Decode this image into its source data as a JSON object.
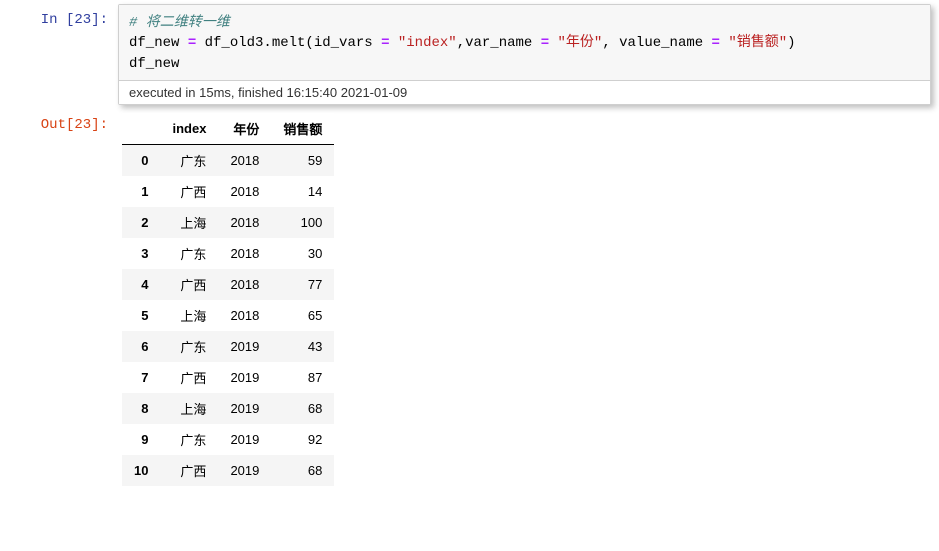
{
  "in_prompt": "In [23]:",
  "out_prompt": "Out[23]:",
  "code": {
    "comment": "# 将二维转一维",
    "line2_pre": "df_new ",
    "eq": "=",
    "line2_mid": " df_old3.melt(id_vars ",
    "line2_s1": "\"index\"",
    "line2_c1": ",var_name ",
    "line2_s2": "\"年份\"",
    "line2_c2": ", value_name ",
    "line2_s3": "\"销售额\"",
    "line2_end": ")",
    "line3": "df_new"
  },
  "exec_info": "executed in 15ms, finished 16:15:40 2021-01-09",
  "chart_data": {
    "type": "table",
    "columns": [
      "index",
      "年份",
      "销售额"
    ],
    "rows": [
      {
        "i": "0",
        "c0": "广东",
        "c1": "2018",
        "c2": "59"
      },
      {
        "i": "1",
        "c0": "广西",
        "c1": "2018",
        "c2": "14"
      },
      {
        "i": "2",
        "c0": "上海",
        "c1": "2018",
        "c2": "100"
      },
      {
        "i": "3",
        "c0": "广东",
        "c1": "2018",
        "c2": "30"
      },
      {
        "i": "4",
        "c0": "广西",
        "c1": "2018",
        "c2": "77"
      },
      {
        "i": "5",
        "c0": "上海",
        "c1": "2018",
        "c2": "65"
      },
      {
        "i": "6",
        "c0": "广东",
        "c1": "2019",
        "c2": "43"
      },
      {
        "i": "7",
        "c0": "广西",
        "c1": "2019",
        "c2": "87"
      },
      {
        "i": "8",
        "c0": "上海",
        "c1": "2019",
        "c2": "68"
      },
      {
        "i": "9",
        "c0": "广东",
        "c1": "2019",
        "c2": "92"
      },
      {
        "i": "10",
        "c0": "广西",
        "c1": "2019",
        "c2": "68"
      }
    ]
  }
}
